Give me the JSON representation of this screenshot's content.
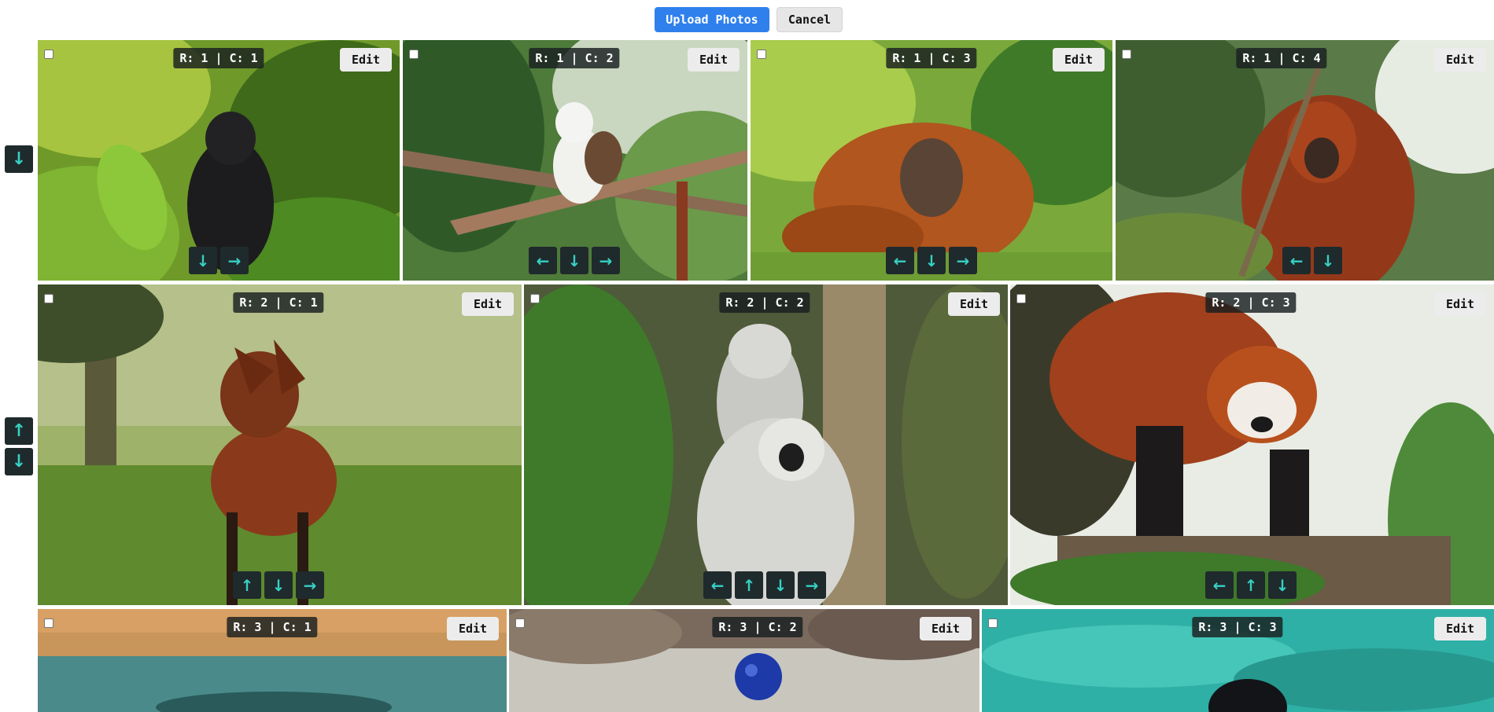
{
  "toolbar": {
    "upload_label": "Upload Photos",
    "cancel_label": "Cancel"
  },
  "icons": {
    "up": "↑",
    "down": "↓",
    "left": "←",
    "right": "→"
  },
  "rows": [
    {
      "row_controls": [
        "down"
      ]
    },
    {
      "row_controls": [
        "up",
        "down"
      ]
    },
    {
      "row_controls": []
    }
  ],
  "photos": [
    {
      "row": 1,
      "col": 1,
      "label": "R: 1 | C: 1",
      "edit": "Edit",
      "subject": "black crested macaque",
      "moves": [
        "down",
        "right"
      ]
    },
    {
      "row": 1,
      "col": 2,
      "label": "R: 1 | C: 2",
      "edit": "Edit",
      "subject": "cotton-top tamarin",
      "moves": [
        "left",
        "down",
        "right"
      ]
    },
    {
      "row": 1,
      "col": 3,
      "label": "R: 1 | C: 3",
      "edit": "Edit",
      "subject": "orangutan",
      "moves": [
        "left",
        "down",
        "right"
      ]
    },
    {
      "row": 1,
      "col": 4,
      "label": "R: 1 | C: 4",
      "edit": "Edit",
      "subject": "red howler monkey",
      "moves": [
        "left",
        "down"
      ]
    },
    {
      "row": 2,
      "col": 1,
      "label": "R: 2 | C: 1",
      "edit": "Edit",
      "subject": "maned wolf",
      "moves": [
        "up",
        "down",
        "right"
      ]
    },
    {
      "row": 2,
      "col": 2,
      "label": "R: 2 | C: 2",
      "edit": "Edit",
      "subject": "ring-tailed lemurs",
      "moves": [
        "left",
        "up",
        "down",
        "right"
      ]
    },
    {
      "row": 2,
      "col": 3,
      "label": "R: 2 | C: 3",
      "edit": "Edit",
      "subject": "red panda",
      "moves": [
        "left",
        "up",
        "down"
      ]
    },
    {
      "row": 3,
      "col": 1,
      "label": "R: 3 | C: 1",
      "edit": "Edit",
      "subject": "water",
      "moves": []
    },
    {
      "row": 3,
      "col": 2,
      "label": "R: 3 | C: 2",
      "edit": "Edit",
      "subject": "blue ball on rocks",
      "moves": []
    },
    {
      "row": 3,
      "col": 3,
      "label": "R: 3 | C: 3",
      "edit": "Edit",
      "subject": "sea lion in turquoise water",
      "moves": []
    }
  ]
}
